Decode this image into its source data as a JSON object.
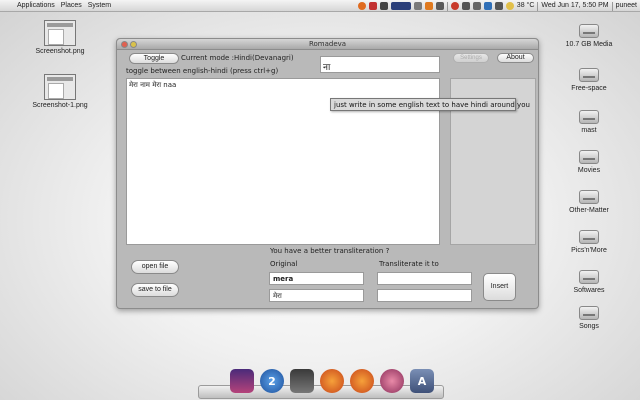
{
  "topbar": {
    "apple_glyph": "",
    "menus": [
      "Applications",
      "Places",
      "System"
    ],
    "temperature": "38 °C",
    "clock": "Wed Jun 17,  5:50 PM",
    "user": "puneet"
  },
  "desktop_left": [
    {
      "label": "Screenshot.png"
    },
    {
      "label": "Screenshot-1.png"
    }
  ],
  "desktop_right": [
    {
      "label": "10.7 GB Media"
    },
    {
      "label": "Free-space"
    },
    {
      "label": "mast"
    },
    {
      "label": "Movies"
    },
    {
      "label": "Other-Matter"
    },
    {
      "label": "Pics'n'More"
    },
    {
      "label": "Softwares"
    },
    {
      "label": "Songs"
    }
  ],
  "window": {
    "title": "Romadeva",
    "toggle_label": "Toggle",
    "current_mode": "Current mode :Hindi(Devanagri)",
    "toggle_hint": "toggle between english-hindi (press ctrl+g)",
    "preview_value": "ना",
    "settings_label": "Settings",
    "about_label": "About",
    "editor_text": "मेरा नाम मेरा naa",
    "tooltip": "just write in some english text to have hindi around you",
    "better_prompt": "You have a better transliteration ?",
    "original_label": "Original",
    "transliterate_label": "Transliterate it to",
    "original_value": "mera",
    "original_hindi": "मेरा",
    "translit_value_1": "",
    "translit_value_2": "",
    "insert_label": "Insert",
    "open_file_label": "open file",
    "save_file_label": "save to file"
  },
  "dock": {
    "icons": [
      "finder-icon",
      "photos-icon",
      "dashboard-icon",
      "terminal-icon",
      "firefox-icon",
      "firefox-alt-icon",
      "itunes-icon",
      "dictionary-icon"
    ],
    "badges": [
      "",
      "",
      "2",
      "",
      "",
      "",
      "",
      "A"
    ]
  },
  "colors": {
    "window_bg": "#b9b9b9",
    "dock_bg": "#d6d6d6"
  }
}
